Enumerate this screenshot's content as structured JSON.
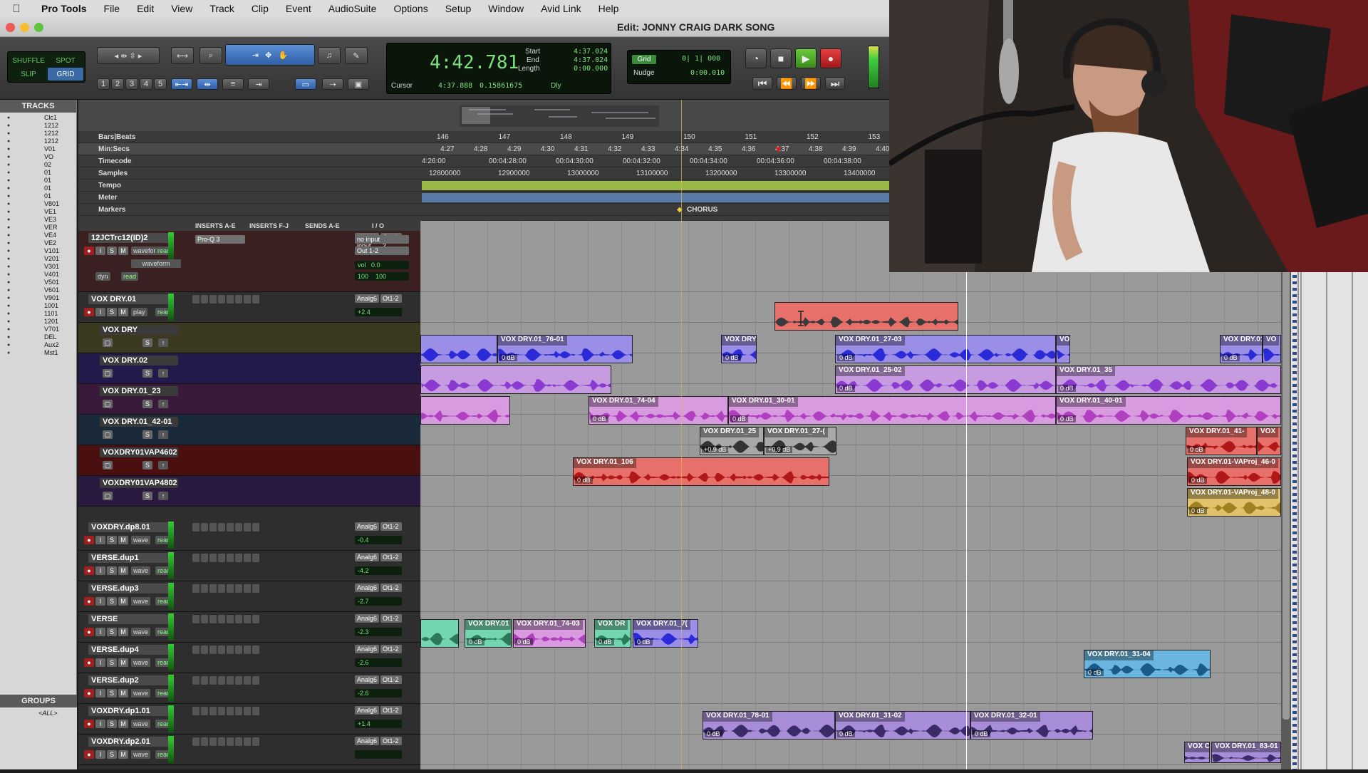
{
  "menubar": {
    "app": "Pro Tools",
    "items": [
      "File",
      "Edit",
      "View",
      "Track",
      "Clip",
      "Event",
      "AudioSuite",
      "Options",
      "Setup",
      "Window",
      "Avid Link",
      "Help"
    ]
  },
  "window": {
    "title": "Edit: JONNY CRAIG DARK SONG"
  },
  "toolbar": {
    "modes": [
      "SHUFFLE",
      "SPOT",
      "SLIP",
      "GRID"
    ],
    "zoom_presets": [
      "1",
      "2",
      "3",
      "4",
      "5"
    ],
    "counter": {
      "main": "4:42.781",
      "start_label": "Start",
      "end_label": "End",
      "length_label": "Length",
      "start": "4:37.024",
      "end": "4:37.024",
      "length": "0:00.000",
      "cursor_label": "Cursor",
      "cursor": "4:37.888",
      "cursor_samples": "0.15861675",
      "dly": "Dly"
    },
    "grid": {
      "label": "Grid",
      "value": "0| 1| 000",
      "nudge_label": "Nudge",
      "nudge_value": "0:00.010"
    }
  },
  "tracks_panel": {
    "title": "TRACKS",
    "items": [
      "Clc1",
      "1212",
      "1212",
      "1212",
      "V01",
      "VO",
      "02",
      "01",
      "01",
      "01",
      "01",
      "V801",
      "VE1",
      "VE3",
      "VER",
      "VE4",
      "VE2",
      "V101",
      "V201",
      "V301",
      "V401",
      "V501",
      "V601",
      "V901",
      "1001",
      "1101",
      "1201",
      "V701",
      "DEL",
      "Aux2",
      "Mst1"
    ],
    "groups_title": "GROUPS",
    "groups": [
      "<ALL>"
    ]
  },
  "rulers": {
    "bars_label": "Bars|Beats",
    "minsecs_label": "Min:Secs",
    "timecode_label": "Timecode",
    "samples_label": "Samples",
    "tempo_label": "Tempo",
    "meter_label": "Meter",
    "markers_label": "Markers",
    "bars": [
      "146",
      "147",
      "148",
      "149",
      "150",
      "151",
      "152",
      "153"
    ],
    "minsecs": [
      "4:27",
      "4:28",
      "4:29",
      "4:30",
      "4:31",
      "4:32",
      "4:33",
      "4:34",
      "4:35",
      "4:36",
      "4:37",
      "4:38",
      "4:39",
      "4:40"
    ],
    "timecode": [
      "4:26:00",
      "00:04:28:00",
      "00:04:30:00",
      "00:04:32:00",
      "00:04:34:00",
      "00:04:36:00",
      "00:04:38:00"
    ],
    "samples": [
      "12800000",
      "12900000",
      "13000000",
      "13100000",
      "13200000",
      "13300000",
      "13400000"
    ],
    "marker": "CHORUS"
  },
  "mix_header": {
    "inserts_ae": "INSERTS A-E",
    "inserts_fj": "INSERTS F-J",
    "sends_ae": "SENDS A-E",
    "io": "I / O"
  },
  "tracks": [
    {
      "name": "12JCTrc12(ID)2",
      "view": "waveform",
      "mode": "read",
      "dyn": "dyn",
      "insert": "Pro-Q 3",
      "input": "no input",
      "output": "Out 1-2",
      "vol": "0.0",
      "pan_l": "100",
      "pan_r": "100",
      "vol_label": "vol"
    },
    {
      "name": "VOX DRY.01",
      "view": "play",
      "mode": "read",
      "input": "Analg6",
      "output": "Ot1-2",
      "vol": "+2.4"
    },
    {
      "name": "VOX DRY"
    },
    {
      "name": "VOX DRY.02"
    },
    {
      "name": "VOX DRY.01_23"
    },
    {
      "name": "VOX DRY.01_42-01"
    },
    {
      "name": "VOXDRY01VAP4602"
    },
    {
      "name": "VOXDRY01VAP4802"
    },
    {
      "name": "VOXDRY.dp8.01",
      "view": "wave",
      "mode": "read",
      "input": "Analg6",
      "output": "Ot1-2",
      "vol": "-0.4"
    },
    {
      "name": "VERSE.dup1",
      "view": "wave",
      "mode": "read",
      "input": "Analg6",
      "output": "Ot1-2",
      "vol": "-4.2"
    },
    {
      "name": "VERSE.dup3",
      "view": "wave",
      "mode": "read",
      "input": "Analg6",
      "output": "Ot1-2",
      "vol": "-2.7"
    },
    {
      "name": "VERSE",
      "view": "wave",
      "mode": "read",
      "input": "Analg6",
      "output": "Ot1-2",
      "vol": "-2.3"
    },
    {
      "name": "VERSE.dup4",
      "view": "wave",
      "mode": "read",
      "input": "Analg6",
      "output": "Ot1-2",
      "vol": "-2.6"
    },
    {
      "name": "VERSE.dup2",
      "view": "wave",
      "mode": "read",
      "input": "Analg6",
      "output": "Ot1-2",
      "vol": "-2.6"
    },
    {
      "name": "VOXDRY.dp1.01",
      "view": "wave",
      "mode": "read",
      "input": "Analg6",
      "output": "Ot1-2",
      "vol": "+1.4"
    },
    {
      "name": "VOXDRY.dp2.01",
      "view": "wave",
      "mode": "read",
      "input": "Analg6",
      "output": "Ot1-2",
      "vol": ""
    }
  ],
  "clips": [
    {
      "name": "",
      "db": "",
      "color": "#e8706a",
      "wave": "#3a3a3a"
    },
    {
      "name": "VOX DRY.01_76-01",
      "db": "0 dB",
      "color": "#9b8ee6",
      "wave": "#2a2ad8"
    },
    {
      "name": "",
      "db": "",
      "color": "#9b8ee6",
      "wave": "#2a2ad8"
    },
    {
      "name": "VOX DRY",
      "db": "0 dB",
      "color": "#9b8ee6",
      "wave": "#2a2ad8"
    },
    {
      "name": "VOX DRY.01_27-03",
      "db": "0 dB",
      "color": "#9b8ee6",
      "wave": "#2a2ad8"
    },
    {
      "name": "VO",
      "db": "",
      "color": "#9b8ee6",
      "wave": "#2a2ad8"
    },
    {
      "name": "VOX DRY.01",
      "db": "0 dB",
      "color": "#9b8ee6",
      "wave": "#2a2ad8"
    },
    {
      "name": "VO",
      "db": "",
      "color": "#9b8ee6",
      "wave": "#2a2ad8"
    },
    {
      "name": "",
      "db": "",
      "color": "#c79be0",
      "wave": "#8a3ad0"
    },
    {
      "name": "VOX DRY.01_25-02",
      "db": "0 dB",
      "color": "#c79be0",
      "wave": "#8a3ad0"
    },
    {
      "name": "VOX DRY.01_35",
      "db": "0 dB",
      "color": "#c79be0",
      "wave": "#8a3ad0"
    },
    {
      "name": "",
      "db": "",
      "color": "#d99be0",
      "wave": "#b040c0"
    },
    {
      "name": "VOX DRY.01_74-04",
      "db": "0 dB",
      "color": "#d99be0",
      "wave": "#b040c0"
    },
    {
      "name": "VOX DRY.01_30-01",
      "db": "0 dB",
      "color": "#d99be0",
      "wave": "#b040c0"
    },
    {
      "name": "VOX DRY.01_40-01",
      "db": "0 dB",
      "color": "#d99be0",
      "wave": "#b040c0"
    },
    {
      "name": "VOX DRY.01_25",
      "db": "+0.9 dB",
      "color": "#a8a8a8",
      "wave": "#333333"
    },
    {
      "name": "VOX DRY.01_27-(",
      "db": "+0.9 dB",
      "color": "#a8a8a8",
      "wave": "#333333"
    },
    {
      "name": "VOX DRY.01_41-",
      "db": "0 dB",
      "color": "#e8706a",
      "wave": "#b01818"
    },
    {
      "name": "VOX",
      "db": "",
      "color": "#e8706a",
      "wave": "#b01818"
    },
    {
      "name": "VOX DRY.01_106",
      "db": "0 dB",
      "color": "#e8706a",
      "wave": "#b01818"
    },
    {
      "name": "VOX DRY.01-VAProj_46-0",
      "db": "0 dB",
      "color": "#e8706a",
      "wave": "#b01818"
    },
    {
      "name": "VOX DRY.01-VAProj_48-0",
      "db": "0 dB",
      "color": "#e2c26a",
      "wave": "#a08020"
    },
    {
      "name": "",
      "db": "",
      "color": "#74d6b0",
      "wave": "#2a7a5a"
    },
    {
      "name": "VOX DRY.01",
      "db": "0 dB",
      "color": "#74d6b0",
      "wave": "#2a7a5a"
    },
    {
      "name": "VOX DRY.01_74-03",
      "db": "0 dB",
      "color": "#d99be0",
      "wave": "#b040c0"
    },
    {
      "name": "VOX DR",
      "db": "0 dB",
      "color": "#74d6b0",
      "wave": "#2a7a5a"
    },
    {
      "name": "VOX DRY.01_7(",
      "db": "0 dB",
      "color": "#9b8ee6",
      "wave": "#2a2ad8"
    },
    {
      "name": "VOX DRY.01_31-04",
      "db": "0 dB",
      "color": "#6ab6e0",
      "wave": "#1a5a8a"
    },
    {
      "name": "VOX DRY.01_78-01",
      "db": "0 dB",
      "color": "#a88ed8",
      "wave": "#3a2a6a"
    },
    {
      "name": "VOX DRY.01_31-02",
      "db": "0 dB",
      "color": "#a88ed8",
      "wave": "#3a2a6a"
    },
    {
      "name": "VOX DRY.01_32-01",
      "db": "0 dB",
      "color": "#a88ed8",
      "wave": "#3a2a6a"
    },
    {
      "name": "VOX C",
      "db": "",
      "color": "#a88ed8",
      "wave": "#3a2a6a"
    },
    {
      "name": "VOX DRY.01_83-01",
      "db": "",
      "color": "#a88ed8",
      "wave": "#3a2a6a"
    }
  ],
  "status": {
    "record": "record"
  }
}
